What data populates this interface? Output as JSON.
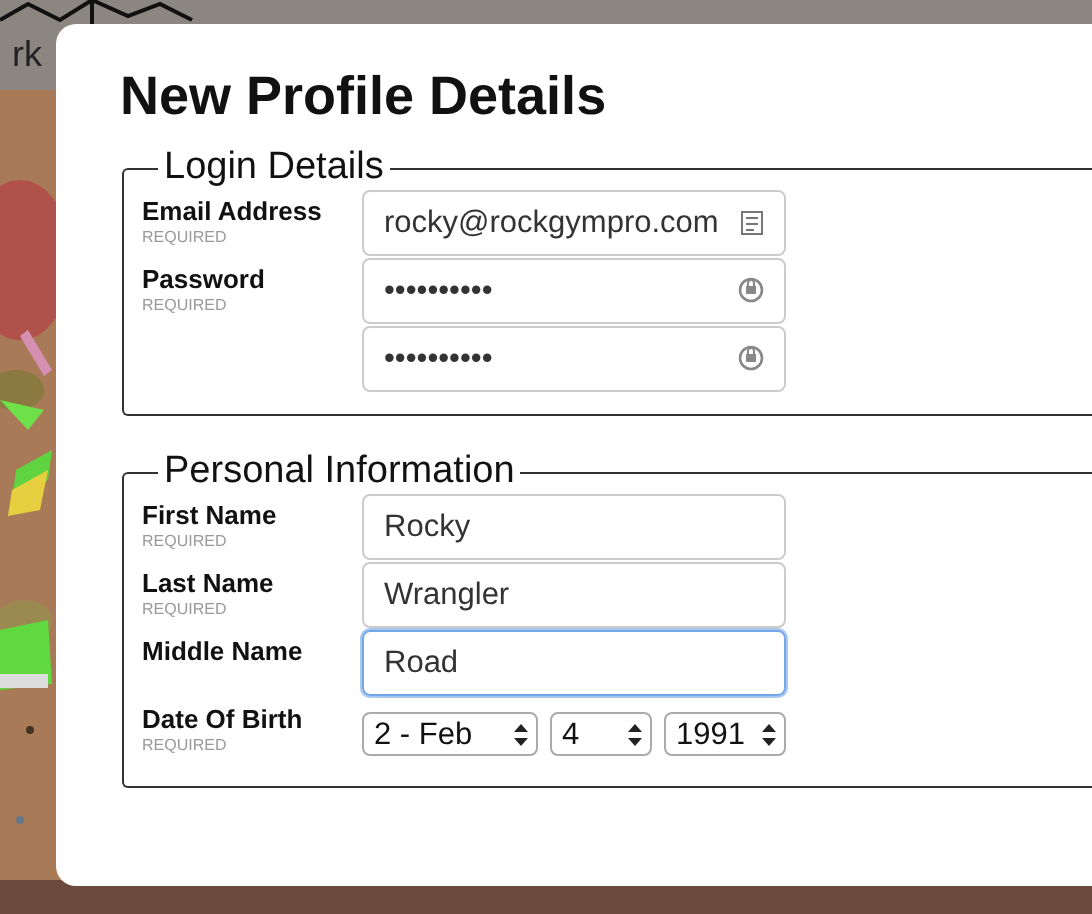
{
  "backdrop": {
    "kind": "picture",
    "header_text": "rk"
  },
  "dialog": {
    "title": "New Profile Details",
    "sections": [
      {
        "legend": "Login Details",
        "rows": [
          {
            "label": "Email Address",
            "note": "REQUIRED",
            "controls": [
              {
                "kind": "email",
                "value": "rocky@rockgympro.com",
                "focused": false
              }
            ]
          },
          {
            "label": "Password",
            "note": "REQUIRED",
            "controls": [
              {
                "kind": "password",
                "value": "••••••••••",
                "focused": false
              }
            ]
          },
          {
            "controls": [
              {
                "kind": "password",
                "value": "••••••••••",
                "focused": false
              }
            ]
          }
        ]
      },
      {
        "legend": "Personal Information",
        "rows": [
          {
            "label": "First Name",
            "note": "REQUIRED",
            "controls": [
              {
                "kind": "text",
                "value": "Rocky",
                "focused": false
              }
            ]
          },
          {
            "label": "Last Name",
            "note": "REQUIRED",
            "controls": [
              {
                "kind": "text",
                "value": "Wrangler",
                "focused": false
              }
            ]
          },
          {
            "label": "Middle Name",
            "controls": [
              {
                "kind": "text",
                "value": "Road",
                "focused": true
              }
            ]
          },
          {
            "label": "Date Of Birth",
            "note": "REQUIRED",
            "controls": [
              {
                "kind": "select",
                "value": "2 - Feb"
              },
              {
                "kind": "select",
                "value": "4"
              },
              {
                "kind": "select",
                "value": "1991"
              }
            ]
          }
        ]
      }
    ]
  }
}
